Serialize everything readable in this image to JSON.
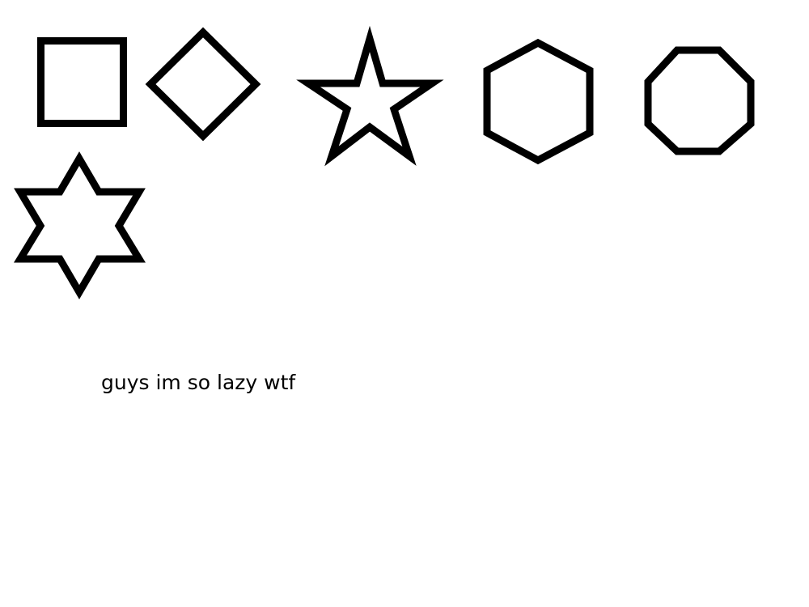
{
  "shapes": [
    {
      "kind": "square",
      "icon": "square-icon"
    },
    {
      "kind": "diamond",
      "icon": "diamond-icon"
    },
    {
      "kind": "five-point-star",
      "icon": "star-icon"
    },
    {
      "kind": "hexagon",
      "icon": "hexagon-icon"
    },
    {
      "kind": "octagon",
      "icon": "octagon-icon"
    },
    {
      "kind": "six-point-star",
      "icon": "hexagram-icon"
    }
  ],
  "caption": "guys im so lazy wtf",
  "colors": {
    "stroke": "#000000",
    "fill": "#ffffff",
    "background": "#ffffff"
  }
}
